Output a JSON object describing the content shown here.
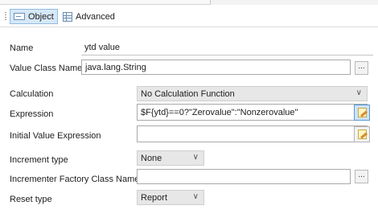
{
  "tabs": {
    "object_label": "Object",
    "advanced_label": "Advanced"
  },
  "form": {
    "name": {
      "label": "Name",
      "value": "ytd value"
    },
    "value_class_name": {
      "label": "Value Class Name",
      "value": "java.lang.String",
      "button": "..."
    },
    "calculation": {
      "label": "Calculation",
      "value": "No Calculation Function"
    },
    "expression": {
      "label": "Expression",
      "value": "$F{ytd}==0?\"Zerovalue\":\"Nonzerovalue\""
    },
    "initial_value_expression": {
      "label": "Initial Value Expression",
      "value": ""
    },
    "increment_type": {
      "label": "Increment type",
      "value": "None"
    },
    "incrementer_factory_class_name": {
      "label": "Incrementer Factory Class Name",
      "value": "",
      "button": "..."
    },
    "reset_type": {
      "label": "Reset type",
      "value": "Report"
    }
  },
  "icons": {
    "object_tab": "object-icon",
    "advanced_tab": "grid-icon",
    "expression_editor": "expression-editor-icon",
    "dropdown": "chevron-down-icon"
  },
  "colors": {
    "active_tab_bg": "#d6e8f7",
    "active_tab_border": "#93bbe0",
    "selected_button_bg": "#cfe3f6"
  }
}
